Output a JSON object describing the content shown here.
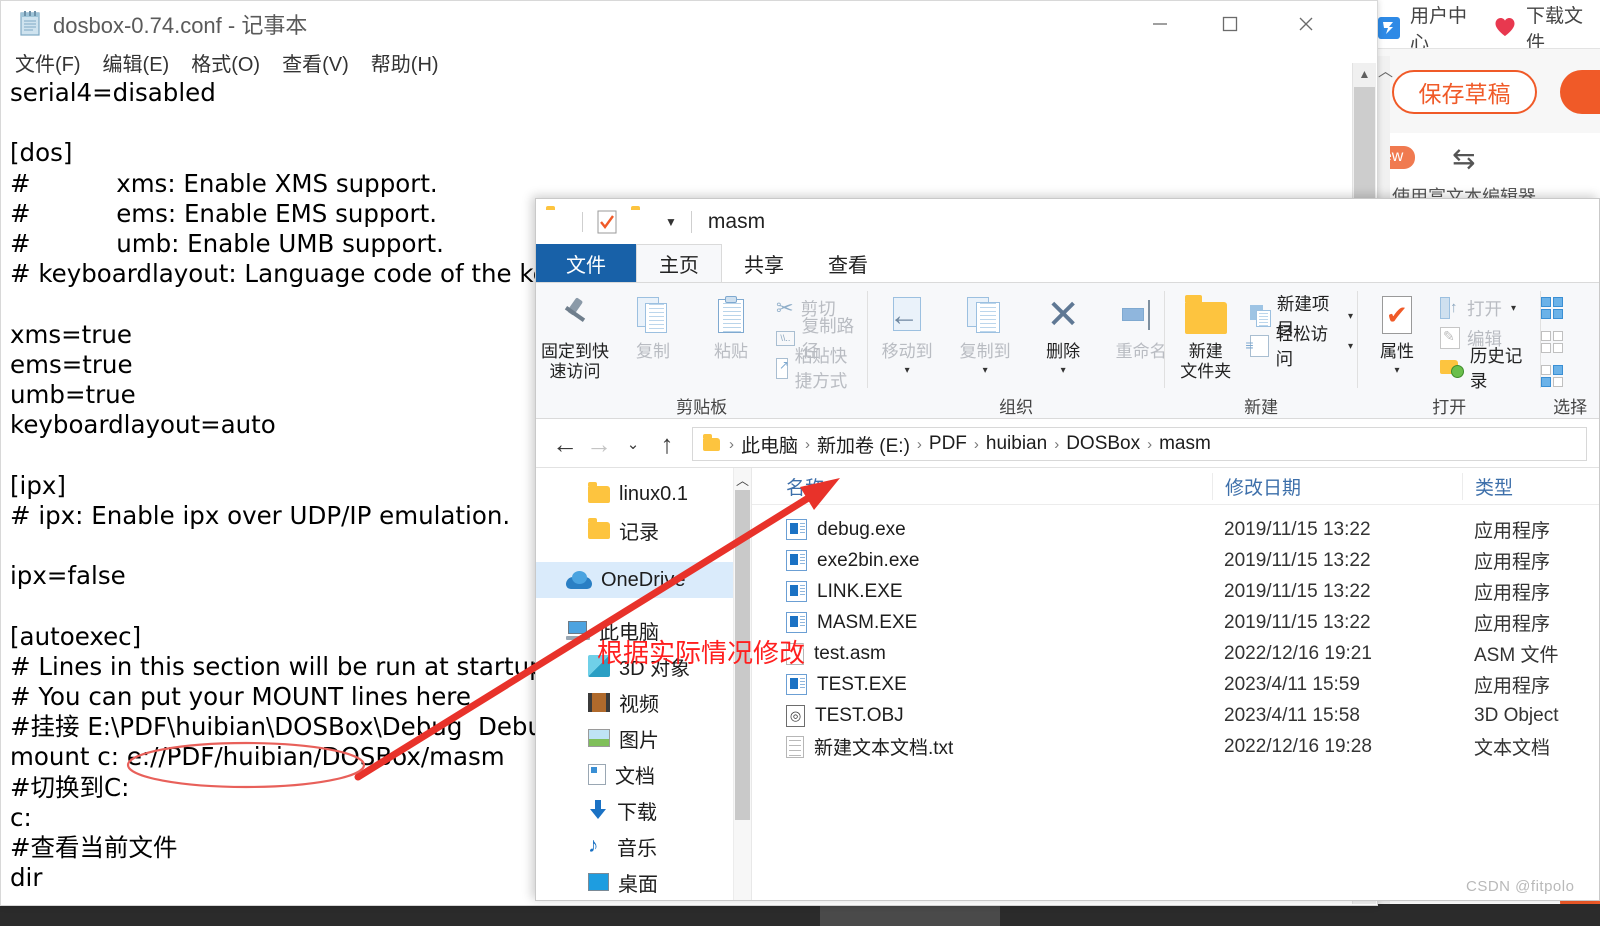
{
  "background_page": {
    "nav_items": [
      {
        "label": "用户中心",
        "icon": "user-center-icon"
      },
      {
        "label": "下载文件",
        "icon": "heart-icon"
      }
    ],
    "save_draft_label": "保存草稿",
    "new_badge": "new",
    "rich_editor_label": "使用富文本编辑器",
    "swap_icon": "⇆"
  },
  "watermark": "CSDN @fitpolo",
  "notepad": {
    "title": "dosbox-0.74.conf - 记事本",
    "icon": "notepad-icon",
    "window_controls": {
      "minimize": "—",
      "maximize": "▢",
      "close": "✕"
    },
    "menu": [
      "文件(F)",
      "编辑(E)",
      "格式(O)",
      "查看(V)",
      "帮助(H)"
    ],
    "content": "serial4=disabled\n\n[dos]\n#           xms: Enable XMS support.\n#           ems: Enable EMS support.\n#           umb: Enable UMB support.\n# keyboardlayout: Language code of the keyboard layout\n\nxms=true\nems=true\numb=true\nkeyboardlayout=auto\n\n[ipx]\n# ipx: Enable ipx over UDP/IP emulation.\n\nipx=false\n\n[autoexec]\n# Lines in this section will be run at startup.\n# You can put your MOUNT lines here.\n#挂接 E:\\PDF\\huibian\\DOSBox\\Debug  Debug\nmount c: e://PDF/huibian/DOSBox/masm\n#切换到C:\nc:\n#查看当前文件\ndir"
  },
  "explorer": {
    "title": "masm",
    "quick_access_icons": [
      "folder-icon",
      "properties-check-icon",
      "folder-icon",
      "chevron-down-icon"
    ],
    "tabs": [
      {
        "label": "文件",
        "active_blue": true
      },
      {
        "label": "主页",
        "selected": true
      },
      {
        "label": "共享"
      },
      {
        "label": "查看"
      }
    ],
    "ribbon": {
      "groups": [
        {
          "title": "剪贴板",
          "big_buttons": [
            {
              "label": "固定到快\n速访问",
              "icon": "pin-icon"
            },
            {
              "label": "复制",
              "icon": "copy-icon",
              "dimmed": true
            },
            {
              "label": "粘贴",
              "icon": "paste-icon"
            }
          ],
          "small_buttons": [
            {
              "label": "剪切",
              "icon": "scissors-icon",
              "dimmed": true
            },
            {
              "label": "复制路径",
              "icon": "copy-path-icon",
              "dimmed": true
            },
            {
              "label": "粘贴快捷方式",
              "icon": "paste-shortcut-icon",
              "dimmed": true
            }
          ]
        },
        {
          "title": "组织",
          "big_buttons": [
            {
              "label": "移动到",
              "icon": "move-to-icon",
              "caret": true,
              "dimmed": true
            },
            {
              "label": "复制到",
              "icon": "copy-to-icon",
              "caret": true,
              "dimmed": true
            },
            {
              "label": "删除",
              "icon": "delete-x-icon",
              "caret": true
            },
            {
              "label": "重命名",
              "icon": "rename-icon",
              "dimmed": true
            }
          ]
        },
        {
          "title": "新建",
          "big_buttons": [
            {
              "label": "新建\n文件夹",
              "icon": "new-folder-icon"
            }
          ],
          "small_buttons": [
            {
              "label": "新建项目",
              "icon": "new-item-icon",
              "caret": true
            },
            {
              "label": "轻松访问",
              "icon": "easy-access-icon",
              "caret": true
            }
          ]
        },
        {
          "title": "打开",
          "big_buttons": [
            {
              "label": "属性",
              "icon": "properties-icon",
              "caret": true
            }
          ],
          "small_buttons": [
            {
              "label": "打开",
              "icon": "open-icon",
              "caret": true,
              "dimmed": true
            },
            {
              "label": "编辑",
              "icon": "edit-icon",
              "dimmed": true
            },
            {
              "label": "历史记录",
              "icon": "history-icon"
            }
          ]
        },
        {
          "title": "选择",
          "small_buttons": [
            {
              "label": "",
              "icon": "select-all-icon"
            },
            {
              "label": "",
              "icon": "select-none-icon"
            },
            {
              "label": "",
              "icon": "invert-selection-icon"
            }
          ]
        }
      ]
    },
    "address_bar": {
      "back_icon": "back-arrow-icon",
      "forward_icon": "forward-arrow-icon",
      "recent_icon": "chevron-down-icon",
      "up_icon": "up-arrow-icon",
      "breadcrumb": [
        "此电脑",
        "新加卷 (E:)",
        "PDF",
        "huibian",
        "DOSBox",
        "masm"
      ],
      "separator": "›"
    },
    "nav_pane": {
      "items": [
        {
          "label": "linux0.1",
          "icon": "folder-icon",
          "indent": true
        },
        {
          "label": "记录",
          "icon": "folder-icon",
          "indent": true
        },
        {
          "label": "OneDrive",
          "icon": "onedrive-icon",
          "selected": true
        },
        {
          "label": "此电脑",
          "icon": "this-pc-icon"
        },
        {
          "label": "3D 对象",
          "icon": "3d-object-icon",
          "indent": true
        },
        {
          "label": "视频",
          "icon": "videos-icon",
          "indent": true
        },
        {
          "label": "图片",
          "icon": "pictures-icon",
          "indent": true
        },
        {
          "label": "文档",
          "icon": "documents-icon",
          "indent": true
        },
        {
          "label": "下载",
          "icon": "downloads-icon",
          "indent": true
        },
        {
          "label": "音乐",
          "icon": "music-icon",
          "indent": true
        },
        {
          "label": "桌面",
          "icon": "desktop-icon",
          "indent": true
        }
      ]
    },
    "file_list": {
      "columns": [
        "名称",
        "修改日期",
        "类型"
      ],
      "rows": [
        {
          "name": "debug.exe",
          "date": "2019/11/15 13:22",
          "type": "应用程序",
          "icon": "exe-icon"
        },
        {
          "name": "exe2bin.exe",
          "date": "2019/11/15 13:22",
          "type": "应用程序",
          "icon": "exe-icon"
        },
        {
          "name": "LINK.EXE",
          "date": "2019/11/15 13:22",
          "type": "应用程序",
          "icon": "exe-icon"
        },
        {
          "name": "MASM.EXE",
          "date": "2019/11/15 13:22",
          "type": "应用程序",
          "icon": "exe-icon"
        },
        {
          "name": "test.asm",
          "date": "2022/12/16 19:21",
          "type": "ASM 文件",
          "icon": "doc-blank-icon"
        },
        {
          "name": "TEST.EXE",
          "date": "2023/4/11 15:59",
          "type": "应用程序",
          "icon": "exe-icon"
        },
        {
          "name": "TEST.OBJ",
          "date": "2023/4/11 15:58",
          "type": "3D Object",
          "icon": "obj-icon"
        },
        {
          "name": "新建文本文档.txt",
          "date": "2022/12/16 19:28",
          "type": "文本文档",
          "icon": "txt-icon"
        }
      ]
    }
  },
  "annotations": {
    "note_text": "根据实际情况修改",
    "color": "#ff1f1f",
    "arrow": "red-arrow-pointing-to-address-bar",
    "ellipse": "red-ellipse-around-mount-path"
  }
}
